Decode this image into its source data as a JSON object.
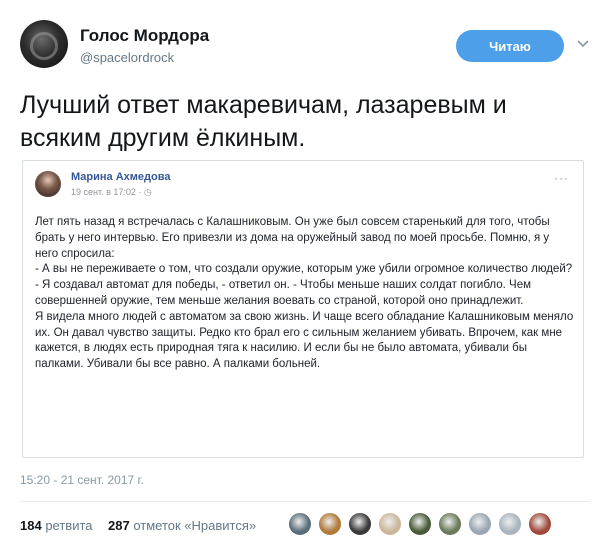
{
  "user": {
    "name": "Голос Мордора",
    "handle": "@spacelordrock"
  },
  "follow_button": "Читаю",
  "tweet_text": "Лучший ответ макаревичам, лазаревым и всяким другим ёлкиным.",
  "quoted": {
    "author": "Марина Ахмедова",
    "meta": "19 сент. в 17:02 · ◷",
    "more": "···",
    "paragraphs": [
      "Лет пять назад я встречалась с Калашниковым. Он уже был совсем старенький для того, чтобы брать у него интервью. Его привезли из дома на оружейный завод по моей просьбе. Помню, я у него спросила:",
      "- А вы не переживаете о том, что создали оружие, которым уже убили огромное количество людей?",
      "- Я создавал автомат для победы, - ответил он. - Чтобы меньше наших солдат погибло. Чем совершенней оружие, тем меньше желания воевать со страной, которой оно принадлежит.",
      "Я видела много людей с автоматом за свою жизнь. И чаще всего обладание Калашниковым меняло их. Он давал чувство защиты. Редко кто брал его с сильным желанием убивать. Впрочем, как мне кажется, в людях есть природная тяга к насилию. И если бы не было автомата, убивали бы палками. Убивали бы все равно. А палками больней."
    ]
  },
  "timestamp": "15:20 - 21 сент. 2017 г.",
  "stats": {
    "retweets_count": "184",
    "retweets_label": "ретвита",
    "likes_count": "287",
    "likes_label": "отметок «Нравится»"
  },
  "likers": [
    {
      "color": "#5a6e7a"
    },
    {
      "color": "#b07a3a"
    },
    {
      "color": "#3a3a3a"
    },
    {
      "color": "#c9b79a"
    },
    {
      "color": "#4a5a3a"
    },
    {
      "color": "#6a7a5a"
    },
    {
      "color": "#9aa6b2"
    },
    {
      "color": "#a8b4bf"
    },
    {
      "color": "#a04a3a"
    }
  ]
}
